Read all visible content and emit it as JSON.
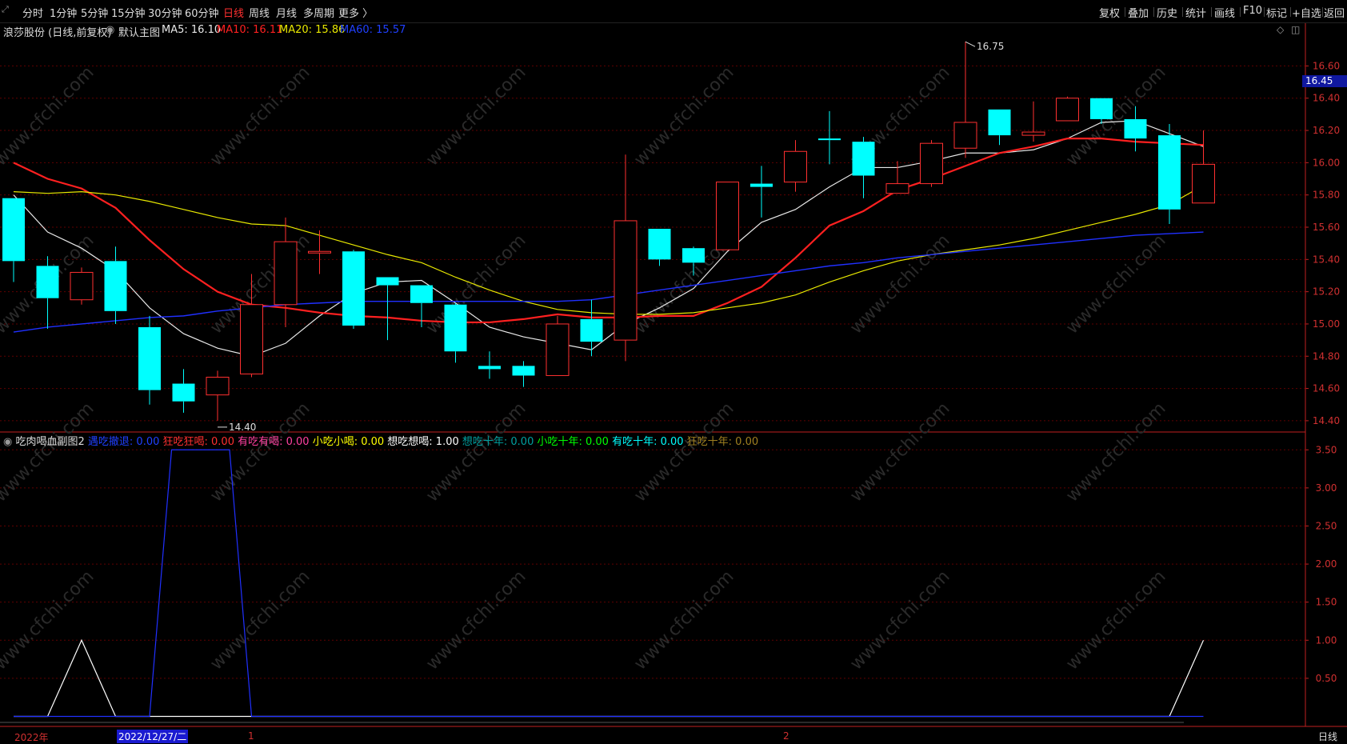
{
  "toolbar": {
    "periods": [
      "分时",
      "1分钟",
      "5分钟",
      "15分钟",
      "30分钟",
      "60分钟",
      "日线",
      "周线",
      "月线",
      "多周期",
      "更多 〉"
    ],
    "active_period": "日线",
    "right_buttons": [
      "复权",
      "叠加",
      "历史",
      "统计",
      "画线",
      "F10",
      "标记",
      "+自选",
      "返回"
    ]
  },
  "main_header": {
    "stock": "浪莎股份 (日线,前复权)",
    "template": "默认主图",
    "ma5": "MA5: 16.10",
    "ma10": "MA10: 16.11",
    "ma20": "MA20: 15.86",
    "ma60": "MA60: 15.57"
  },
  "sub_header": {
    "name": "吃肉喝血副图2",
    "items": [
      {
        "text": "遇吃撤退: 0.00",
        "color": "#2040ff"
      },
      {
        "text": "狂吃狂喝: 0.00",
        "color": "#ff3030"
      },
      {
        "text": "有吃有喝: 0.00",
        "color": "#ff40a0"
      },
      {
        "text": "小吃小喝: 0.00",
        "color": "#ffff00"
      },
      {
        "text": "想吃想喝: 1.00",
        "color": "#ffffff"
      },
      {
        "text": "想吃十年: 0.00",
        "color": "#00a0a0"
      },
      {
        "text": "小吃十年: 0.00",
        "color": "#00ff00"
      },
      {
        "text": "有吃十年: 0.00",
        "color": "#00ffff"
      },
      {
        "text": "狂吃十年: 0.00",
        "color": "#a08020"
      }
    ]
  },
  "price_badge": "16.45",
  "annotations": {
    "high": "16.75",
    "low": "14.40"
  },
  "bottom_bar": {
    "year": "2022年",
    "date_cursor": "2022/12/27/二",
    "m1": "1",
    "m2": "2",
    "period": "日线"
  },
  "watermark": "www.cfchi.com",
  "colors": {
    "up": "#ff3030",
    "down": "#00ffff",
    "ma5": "#e8e8e8",
    "ma10": "#ff2020",
    "ma20": "#e8e800",
    "ma60": "#2030ff",
    "axis": "#c02020",
    "grid": "#600000"
  },
  "chart_data": [
    {
      "type": "candlestick",
      "title": "浪莎股份 (日线,前复权)",
      "y_ticks": [
        "16.60",
        "16.40",
        "16.20",
        "16.00",
        "15.80",
        "15.60",
        "15.40",
        "15.20",
        "15.00",
        "14.80",
        "14.60",
        "14.40"
      ],
      "ylim": [
        14.34,
        16.86
      ],
      "candles": [
        {
          "o": 15.78,
          "c": 15.39,
          "h": 15.78,
          "l": 15.26
        },
        {
          "o": 15.36,
          "c": 15.16,
          "h": 15.42,
          "l": 14.97
        },
        {
          "o": 15.15,
          "c": 15.32,
          "h": 15.35,
          "l": 15.12
        },
        {
          "o": 15.39,
          "c": 15.08,
          "h": 15.48,
          "l": 15.0
        },
        {
          "o": 14.98,
          "c": 14.59,
          "h": 15.05,
          "l": 14.5
        },
        {
          "o": 14.63,
          "c": 14.52,
          "h": 14.72,
          "l": 14.45
        },
        {
          "o": 14.56,
          "c": 14.67,
          "h": 14.71,
          "l": 14.4
        },
        {
          "o": 14.69,
          "c": 15.12,
          "h": 15.31,
          "l": 14.67
        },
        {
          "o": 15.12,
          "c": 15.51,
          "h": 15.66,
          "l": 14.98
        },
        {
          "o": 15.44,
          "c": 15.45,
          "h": 15.58,
          "l": 15.31
        },
        {
          "o": 15.45,
          "c": 14.99,
          "h": 15.46,
          "l": 14.97
        },
        {
          "o": 15.29,
          "c": 15.24,
          "h": 15.29,
          "l": 14.9
        },
        {
          "o": 15.24,
          "c": 15.13,
          "h": 15.24,
          "l": 14.98
        },
        {
          "o": 15.12,
          "c": 14.83,
          "h": 15.13,
          "l": 14.76
        },
        {
          "o": 14.74,
          "c": 14.72,
          "h": 14.83,
          "l": 14.66
        },
        {
          "o": 14.74,
          "c": 14.68,
          "h": 14.77,
          "l": 14.61
        },
        {
          "o": 14.68,
          "c": 15.0,
          "h": 15.05,
          "l": 14.68
        },
        {
          "o": 15.03,
          "c": 14.89,
          "h": 15.15,
          "l": 14.8
        },
        {
          "o": 14.9,
          "c": 15.64,
          "h": 16.05,
          "l": 14.77
        },
        {
          "o": 15.59,
          "c": 15.4,
          "h": 15.59,
          "l": 15.36
        },
        {
          "o": 15.47,
          "c": 15.38,
          "h": 15.48,
          "l": 15.3
        },
        {
          "o": 15.46,
          "c": 15.88,
          "h": 15.88,
          "l": 15.46
        },
        {
          "o": 15.87,
          "c": 15.85,
          "h": 15.98,
          "l": 15.66
        },
        {
          "o": 15.88,
          "c": 16.07,
          "h": 16.14,
          "l": 15.82
        },
        {
          "o": 16.15,
          "c": 16.14,
          "h": 16.32,
          "l": 15.99
        },
        {
          "o": 16.13,
          "c": 15.92,
          "h": 16.16,
          "l": 15.78
        },
        {
          "o": 15.81,
          "c": 15.87,
          "h": 16.01,
          "l": 15.81
        },
        {
          "o": 15.87,
          "c": 16.12,
          "h": 16.14,
          "l": 15.85
        },
        {
          "o": 16.09,
          "c": 16.25,
          "h": 16.75,
          "l": 16.03
        },
        {
          "o": 16.33,
          "c": 16.17,
          "h": 16.33,
          "l": 16.11
        },
        {
          "o": 16.17,
          "c": 16.19,
          "h": 16.38,
          "l": 16.13
        },
        {
          "o": 16.26,
          "c": 16.4,
          "h": 16.41,
          "l": 16.26
        },
        {
          "o": 16.4,
          "c": 16.27,
          "h": 16.4,
          "l": 16.24
        },
        {
          "o": 16.27,
          "c": 16.15,
          "h": 16.35,
          "l": 16.07
        },
        {
          "o": 16.17,
          "c": 15.71,
          "h": 16.24,
          "l": 15.62
        },
        {
          "o": 15.75,
          "c": 15.99,
          "h": 16.2,
          "l": 15.75
        }
      ],
      "series": [
        {
          "name": "MA5",
          "values": [
            15.8,
            15.57,
            15.47,
            15.33,
            15.1,
            14.94,
            14.85,
            14.8,
            14.88,
            15.05,
            15.19,
            15.26,
            15.27,
            15.13,
            14.98,
            14.92,
            14.88,
            14.84,
            15.0,
            15.1,
            15.22,
            15.45,
            15.63,
            15.71,
            15.85,
            15.97,
            15.97,
            16.01,
            16.06,
            16.06,
            16.08,
            16.15,
            16.25,
            16.26,
            16.18,
            16.1
          ]
        },
        {
          "name": "MA10",
          "values": [
            16.0,
            15.9,
            15.84,
            15.72,
            15.52,
            15.34,
            15.2,
            15.12,
            15.1,
            15.07,
            15.05,
            15.04,
            15.02,
            15.01,
            15.01,
            15.03,
            15.06,
            15.04,
            15.04,
            15.05,
            15.05,
            15.13,
            15.23,
            15.41,
            15.61,
            15.7,
            15.83,
            15.9,
            15.98,
            16.06,
            16.1,
            16.15,
            16.15,
            16.13,
            16.12,
            16.11
          ]
        },
        {
          "name": "MA20",
          "values": [
            15.82,
            15.81,
            15.82,
            15.8,
            15.76,
            15.71,
            15.66,
            15.62,
            15.61,
            15.55,
            15.49,
            15.43,
            15.38,
            15.29,
            15.21,
            15.14,
            15.09,
            15.07,
            15.06,
            15.06,
            15.07,
            15.1,
            15.13,
            15.18,
            15.26,
            15.33,
            15.39,
            15.43,
            15.46,
            15.49,
            15.53,
            15.58,
            15.63,
            15.68,
            15.74,
            15.86
          ]
        },
        {
          "name": "MA60",
          "values": [
            14.95,
            14.98,
            15.0,
            15.02,
            15.04,
            15.05,
            15.08,
            15.1,
            15.12,
            15.13,
            15.14,
            15.14,
            15.14,
            15.14,
            15.14,
            15.14,
            15.14,
            15.15,
            15.18,
            15.21,
            15.24,
            15.27,
            15.3,
            15.33,
            15.36,
            15.38,
            15.41,
            15.43,
            15.45,
            15.47,
            15.49,
            15.51,
            15.53,
            15.55,
            15.56,
            15.57
          ]
        }
      ]
    },
    {
      "type": "line",
      "title": "吃肉喝血副图2",
      "y_ticks": [
        "3.50",
        "3.00",
        "2.50",
        "2.00",
        "1.50",
        "1.00",
        "0.50"
      ],
      "ylim": [
        -0.1,
        3.65
      ],
      "series": [
        {
          "name": "想吃想喝",
          "values": [
            0,
            0,
            1,
            0,
            0,
            0,
            0,
            0,
            0,
            0,
            0,
            0,
            0,
            0,
            0,
            0,
            0,
            0,
            0,
            0,
            0,
            0,
            0,
            0,
            0,
            0,
            0,
            0,
            0,
            0,
            0,
            0,
            0,
            0,
            0,
            1
          ]
        },
        {
          "name": "遇吃撤退",
          "values": [
            0,
            0,
            0,
            0,
            0,
            3.5,
            3.5,
            0,
            0,
            0,
            0,
            0,
            0,
            0,
            0,
            0,
            0,
            0,
            0,
            0,
            0,
            0,
            0,
            0,
            0,
            0,
            0,
            0,
            0,
            0,
            0,
            0,
            0,
            0,
            0,
            0
          ]
        }
      ]
    }
  ]
}
